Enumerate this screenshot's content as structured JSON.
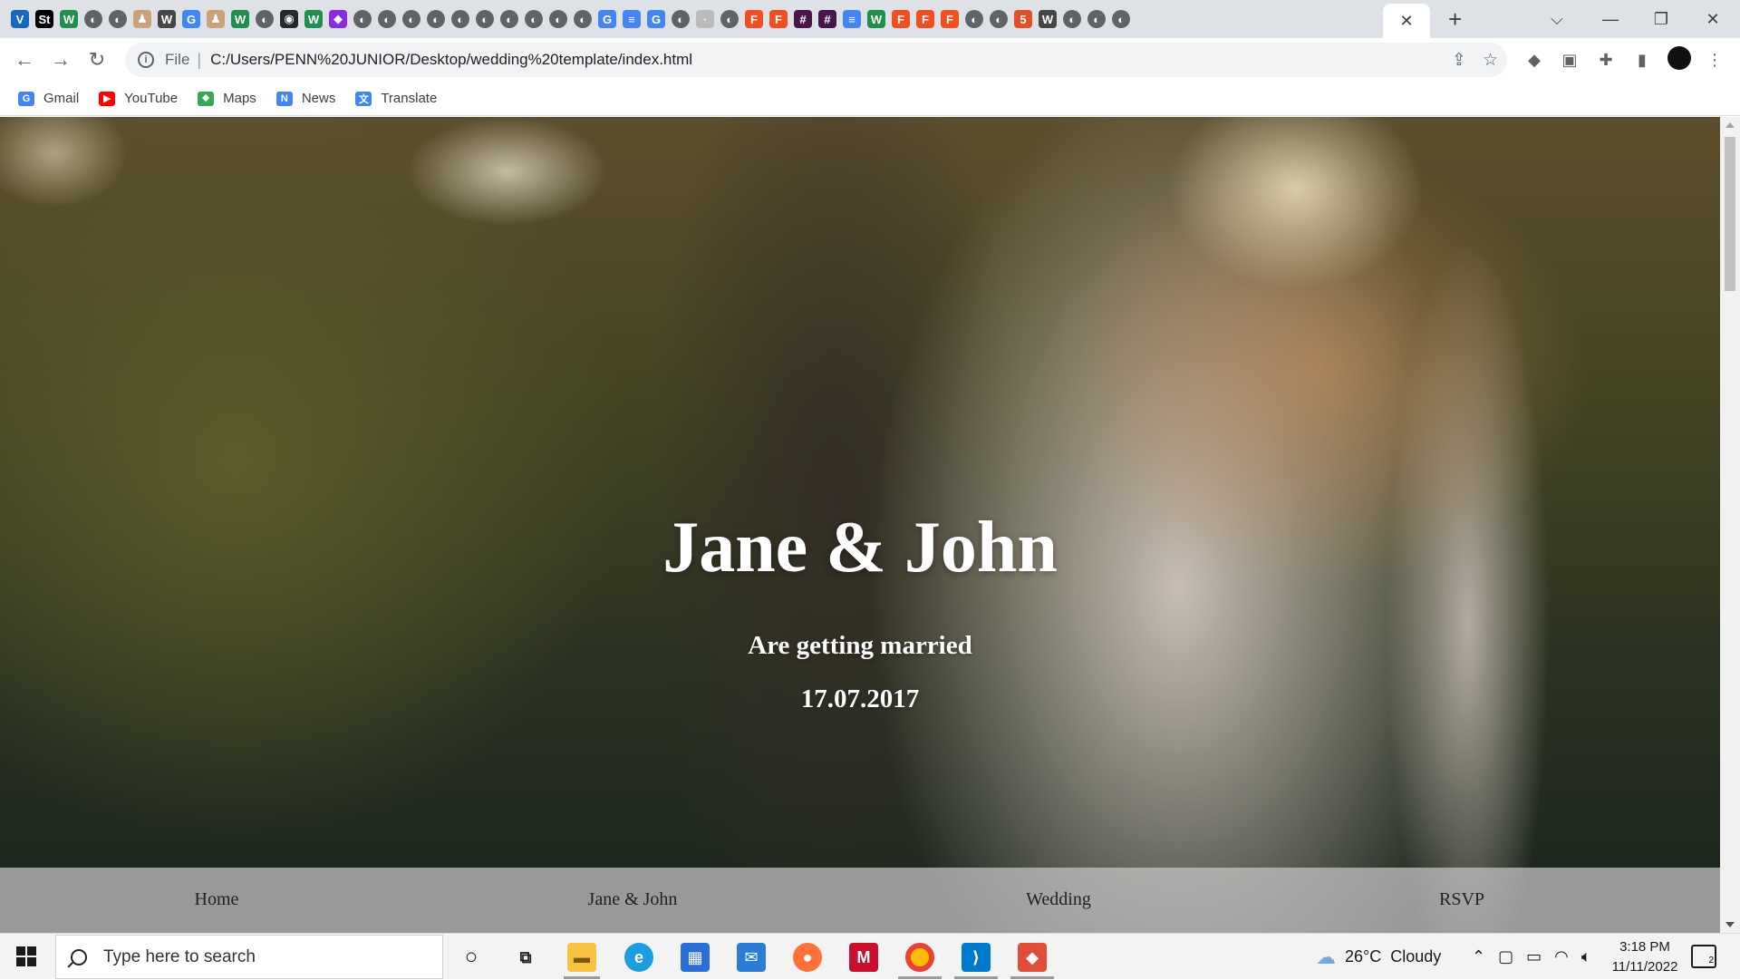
{
  "browser": {
    "tab_icons": [
      "vuetify-icon",
      "studio-icon",
      "w-icon",
      "chrome-icon",
      "chrome-icon",
      "figure-icon",
      "wordpress-icon",
      "google-icon",
      "figure-icon",
      "w-icon",
      "chrome-icon",
      "github-icon",
      "w-icon",
      "gem-icon",
      "chrome-icon",
      "chrome-icon",
      "chrome-icon",
      "chrome-icon",
      "chrome-icon",
      "chrome-icon",
      "chrome-icon",
      "chrome-icon",
      "chrome-icon",
      "chrome-icon",
      "google-icon",
      "docs-icon",
      "google-icon",
      "chrome-icon",
      "dot-icon",
      "chrome-icon",
      "figma-icon",
      "figma-icon",
      "slack-icon",
      "slack-icon",
      "docs-icon",
      "w-icon",
      "figma-icon",
      "figma-icon",
      "figma-icon",
      "chrome-icon",
      "chrome-icon",
      "html5-icon",
      "wordpress-icon",
      "chrome-icon",
      "chrome-icon",
      "chrome-icon"
    ],
    "active_tab_close": "✕",
    "new_tab": "+",
    "window_controls": {
      "tab_search": "⌵",
      "minimize": "—",
      "maximize": "❐",
      "close": "✕"
    },
    "address": {
      "scheme_label": "File",
      "url": "C:/Users/PENN%20JUNIOR/Desktop/wedding%20template/index.html"
    },
    "bookmarks": [
      {
        "label": "Gmail",
        "icon": "google-icon",
        "color": "#4285f4"
      },
      {
        "label": "YouTube",
        "icon": "youtube-icon",
        "color": "#ff0000"
      },
      {
        "label": "Maps",
        "icon": "maps-icon",
        "color": "#34a853"
      },
      {
        "label": "News",
        "icon": "news-icon",
        "color": "#4285f4"
      },
      {
        "label": "Translate",
        "icon": "translate-icon",
        "color": "#4285f4"
      }
    ]
  },
  "page": {
    "hero": {
      "title": "Jane & John",
      "subtitle": "Are getting married",
      "date": "17.07.2017"
    },
    "nav": {
      "home": "Home",
      "couple": "Jane & John",
      "wedding": "Wedding",
      "rsvp": "RSVP"
    }
  },
  "taskbar": {
    "search_placeholder": "Type here to search",
    "weather": {
      "temp": "26°C",
      "condition": "Cloudy"
    },
    "clock": {
      "time": "3:18 PM",
      "date": "11/11/2022"
    },
    "notifications": "2"
  }
}
